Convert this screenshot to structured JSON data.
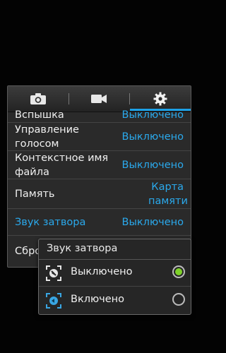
{
  "tabs": [
    {
      "name": "camera-tab",
      "icon": "camera-icon"
    },
    {
      "name": "video-tab",
      "icon": "video-camera-icon"
    },
    {
      "name": "settings-tab",
      "icon": "gear-icon",
      "selected": true
    }
  ],
  "accent_color": "#1da1e6",
  "settings": [
    {
      "label": "Вспышка",
      "value": "Выключено"
    },
    {
      "label": "Управление голосом",
      "value": "Выключено"
    },
    {
      "label": "Контекстное имя файла",
      "value": "Выключено"
    },
    {
      "label": "Память",
      "value": "Карта памяти"
    },
    {
      "label": "Звук затвора",
      "value": "Выключено"
    },
    {
      "label": "Сбро",
      "value": ""
    }
  ],
  "popup": {
    "title": "Звук затвора",
    "options": [
      {
        "label": "Выключено",
        "icon": "shutter-sound-off-icon",
        "selected": true
      },
      {
        "label": "Включено",
        "icon": "shutter-sound-on-icon",
        "selected": false
      }
    ]
  }
}
